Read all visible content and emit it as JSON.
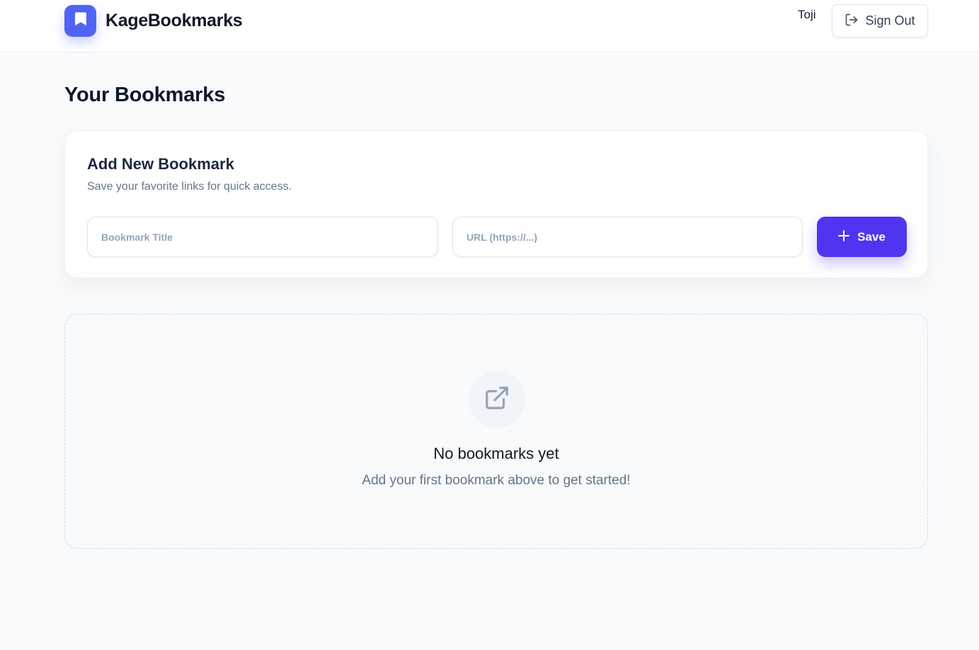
{
  "header": {
    "brand": "KageBookmarks",
    "logo_icon": "bookmark-icon",
    "user_name": "Toji",
    "sign_out_label": "Sign Out",
    "sign_out_icon": "sign-out-icon"
  },
  "page": {
    "title": "Your Bookmarks"
  },
  "add_form": {
    "title": "Add New Bookmark",
    "subtitle": "Save your favorite links for quick access.",
    "title_placeholder": "Bookmark Title",
    "title_value": "",
    "url_placeholder": "URL (https://...)",
    "url_value": "",
    "save_label": "Save",
    "save_icon": "plus-icon"
  },
  "empty_state": {
    "icon": "external-link-icon",
    "title": "No bookmarks yet",
    "subtitle": "Add your first bookmark above to get started!"
  },
  "colors": {
    "accent": "#4f35ef",
    "logo": "#4f64f5",
    "background": "#f8fafc"
  }
}
